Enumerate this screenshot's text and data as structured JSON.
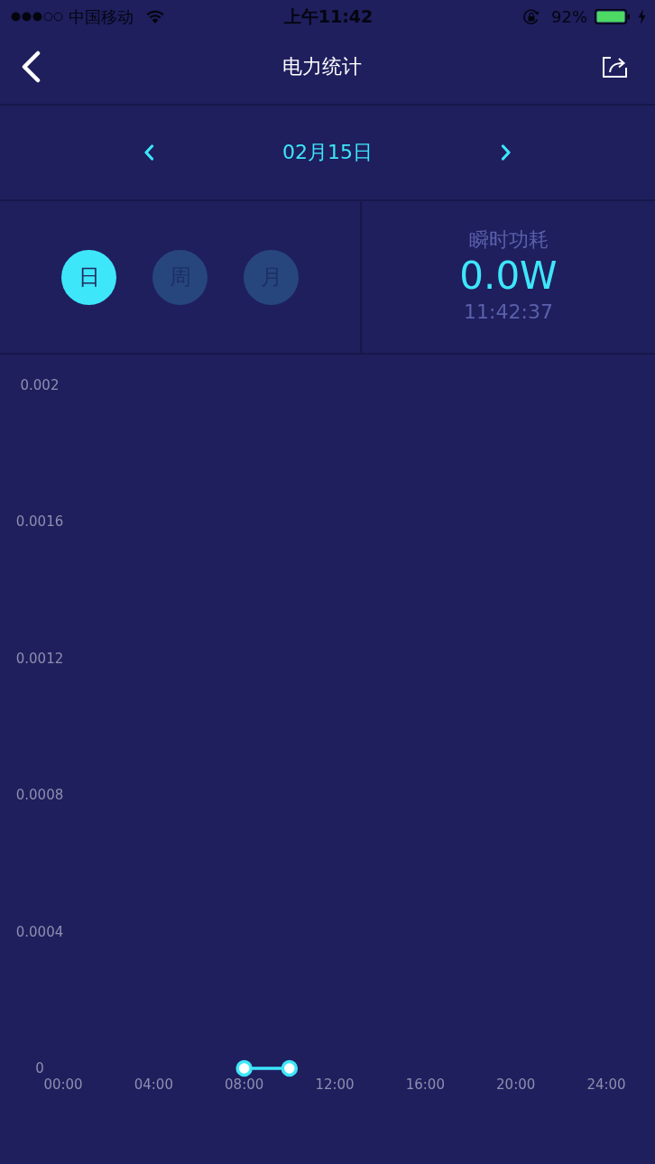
{
  "status_bar": {
    "carrier": "中国移动",
    "time": "上午11:42",
    "battery": "92%"
  },
  "nav_bar": {
    "title": "电力统计"
  },
  "date_nav": {
    "date": "02月15日"
  },
  "period_tabs": [
    {
      "label": "日",
      "selected": true
    },
    {
      "label": "周",
      "selected": false
    },
    {
      "label": "月",
      "selected": false
    }
  ],
  "power": {
    "label": "瞬时功耗",
    "value": "0.0W",
    "time": "11:42:37"
  },
  "chart": {
    "chart_data": {
      "type": "line",
      "x": [
        8,
        10
      ],
      "series": [
        {
          "color": "#3ee6fa",
          "marker": true,
          "values": [
            0,
            0
          ]
        }
      ],
      "xlim": [
        0,
        24
      ],
      "ylim": [
        0,
        0.002
      ],
      "xticks": [
        {
          "value": 0,
          "label": "00:00"
        },
        {
          "value": 4,
          "label": "04:00"
        },
        {
          "value": 8,
          "label": "08:00"
        },
        {
          "value": 12,
          "label": "12:00"
        },
        {
          "value": 16,
          "label": "16:00"
        },
        {
          "value": 20,
          "label": "20:00"
        },
        {
          "value": 24,
          "label": "24:00"
        }
      ],
      "yticks": [
        0,
        0.0004,
        0.0008,
        0.0012,
        0.0016,
        0.002
      ]
    }
  }
}
